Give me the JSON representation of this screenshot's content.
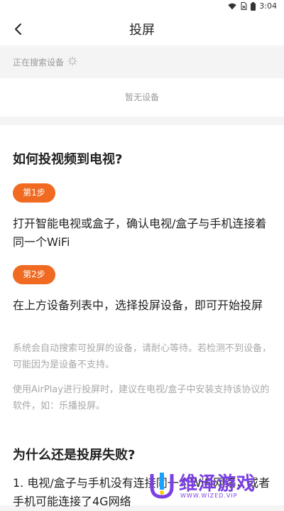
{
  "status_bar": {
    "time": "3:04"
  },
  "header": {
    "title": "投屏"
  },
  "search": {
    "status_text": "正在搜索设备",
    "empty_text": "暂无设备"
  },
  "help": {
    "heading": "如何投视频到电视?",
    "steps": [
      {
        "badge": "第1步",
        "text": "打开智能电视或盒子，确认电视/盒子与手机连接着同一个WiFi"
      },
      {
        "badge": "第2步",
        "text": "在上方设备列表中，选择投屏设备，即可开始投屏"
      }
    ],
    "notes": [
      "系统会自动搜索可投屏的设备，请耐心等待。若检测不到设备，可能因为是设备不支持。",
      "使用AirPlay进行投屏时，建议在电视/盒子中安装支持该协议的软件，如：乐播投屏。"
    ],
    "failure_heading": "为什么还是投屏失败?",
    "failure_item_1": "1. 电视/盒子与手机没有连接同一个WiFi网络，或者手机可能连接了4G网络"
  },
  "watermark": {
    "name": "维泽游戏",
    "url": "WWW.WIZED.VIP"
  },
  "colors": {
    "accent": "#f06a22",
    "background": "#f4f4f4",
    "watermark": "#7b3fe4"
  }
}
